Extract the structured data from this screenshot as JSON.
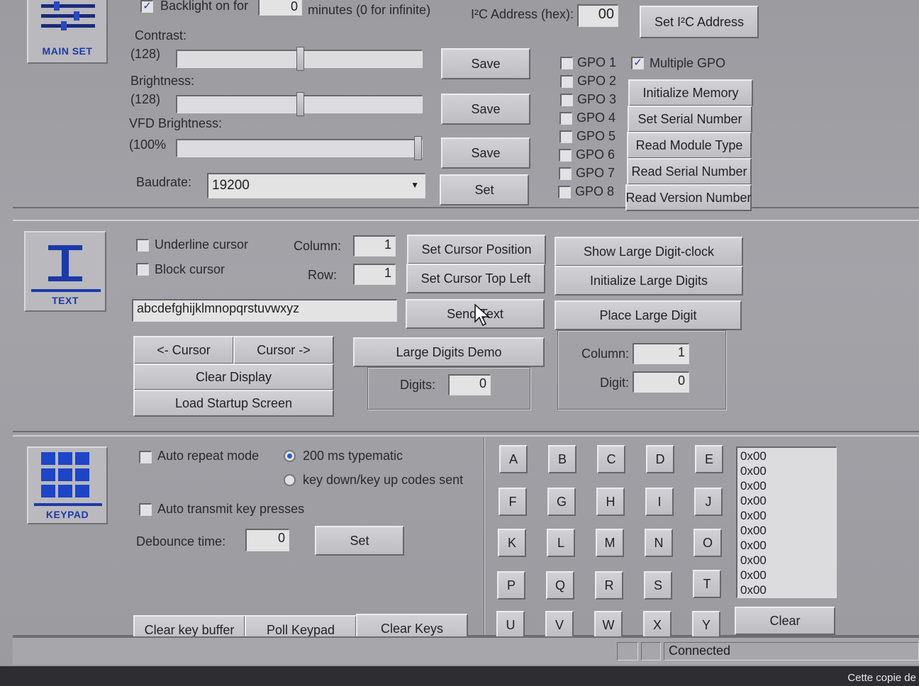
{
  "main_set": {
    "icon_caption": "MAIN SET",
    "backlight": {
      "label": "Backlight on for",
      "checked": true,
      "value": "0",
      "suffix": "minutes (0 for infinite)"
    },
    "i2c": {
      "label": "I²C Address (hex):",
      "value": "00",
      "button": "Set I²C Address"
    },
    "contrast": {
      "label": "Contrast:",
      "value_text": "(128)",
      "level": 0.5,
      "save": "Save"
    },
    "brightness": {
      "label": "Brightness:",
      "value_text": "(128)",
      "level": 0.5,
      "save": "Save"
    },
    "vfd_brightness": {
      "label": "VFD Brightness:",
      "value_text": "(100%",
      "level": 1.0,
      "save": "Save"
    },
    "baudrate": {
      "label": "Baudrate:",
      "value": "19200",
      "set": "Set"
    },
    "gpo": [
      "GPO 1",
      "GPO 2",
      "GPO 3",
      "GPO 4",
      "GPO 5",
      "GPO 6",
      "GPO 7",
      "GPO 8"
    ],
    "multiple_gpo": {
      "label": "Multiple GPO",
      "checked": true
    },
    "actions": [
      "Initialize Memory",
      "Set Serial Number",
      "Read Module Type",
      "Read Serial Number",
      "Read Version Number"
    ]
  },
  "text": {
    "icon_caption": "TEXT",
    "underline_cursor": "Underline cursor",
    "block_cursor": "Block cursor",
    "column_label": "Column:",
    "column_value": "1",
    "row_label": "Row:",
    "row_value": "1",
    "set_cursor_position": "Set Cursor Position",
    "set_cursor_top_left": "Set Cursor Top Left",
    "text_value": "abcdefghijklmnopqrstuvwxyz",
    "send_text": "Send Text",
    "cursor_left": "<- Cursor",
    "cursor_right": "Cursor ->",
    "clear_display": "Clear Display",
    "load_startup_screen": "Load Startup Screen",
    "large_digits_demo": "Large Digits Demo",
    "digits_label": "Digits:",
    "digits_value": "0",
    "show_large_digit_clock": "Show Large Digit-clock",
    "initialize_large_digits": "Initialize Large Digits",
    "place_large_digit": "Place Large Digit",
    "ld_column_label": "Column:",
    "ld_column_value": "1",
    "ld_digit_label": "Digit:",
    "ld_digit_value": "0"
  },
  "keypad": {
    "icon_caption": "KEYPAD",
    "auto_repeat_mode": "Auto repeat mode",
    "typematic_200": "200 ms typematic",
    "key_codes": "key down/key up codes sent",
    "auto_transmit": "Auto transmit key presses",
    "debounce_label": "Debounce time:",
    "debounce_value": "0",
    "debounce_set": "Set",
    "clear_key_buffer": "Clear key buffer",
    "poll_keypad": "Poll Keypad",
    "clear_keys": "Clear Keys",
    "keys": [
      "A",
      "B",
      "C",
      "D",
      "E",
      "F",
      "G",
      "H",
      "I",
      "J",
      "K",
      "L",
      "M",
      "N",
      "O",
      "P",
      "Q",
      "R",
      "S",
      "T",
      "U",
      "V",
      "W",
      "X",
      "Y"
    ],
    "codes": [
      "0x00",
      "0x00",
      "0x00",
      "0x00",
      "0x00",
      "0x00",
      "0x00",
      "0x00",
      "0x00",
      "0x00"
    ],
    "clear": "Clear"
  },
  "status": {
    "connection": "Connected"
  },
  "watermark": "Cette copie de"
}
